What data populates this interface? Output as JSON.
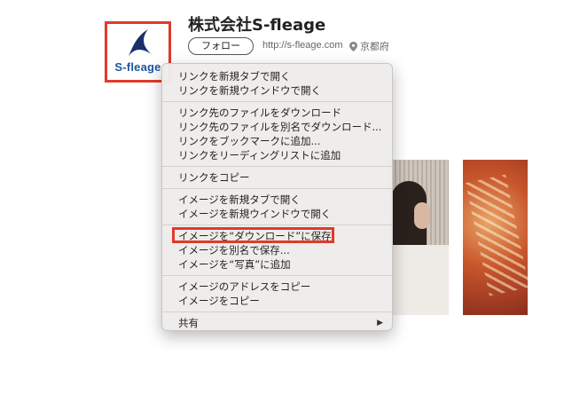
{
  "logo": {
    "text": "S-fleage",
    "icon": "wave-logo-icon"
  },
  "header": {
    "company_name": "株式会社S-fleage",
    "follow_label": "フォロー",
    "url": "http://s-fleage.com",
    "location": "京都府"
  },
  "context_menu": {
    "groups": [
      [
        "リンクを新規タブで開く",
        "リンクを新規ウインドウで開く"
      ],
      [
        "リンク先のファイルをダウンロード",
        "リンク先のファイルを別名でダウンロード...",
        "リンクをブックマークに追加...",
        "リンクをリーディングリストに追加"
      ],
      [
        "リンクをコピー"
      ],
      [
        "イメージを新規タブで開く",
        "イメージを新規ウインドウで開く"
      ],
      [
        "イメージを“ダウンロード”に保存",
        "イメージを別名で保存...",
        "イメージを“写真”に追加"
      ],
      [
        "イメージのアドレスをコピー",
        "イメージをコピー"
      ],
      [
        "共有"
      ]
    ],
    "highlighted_item": "イメージを“ダウンロード”に保存",
    "submenu_arrow": "▶"
  },
  "colors": {
    "highlight": "#e03a2b",
    "logo_blue": "#1e56a0",
    "menu_bg": "#eeecea"
  }
}
